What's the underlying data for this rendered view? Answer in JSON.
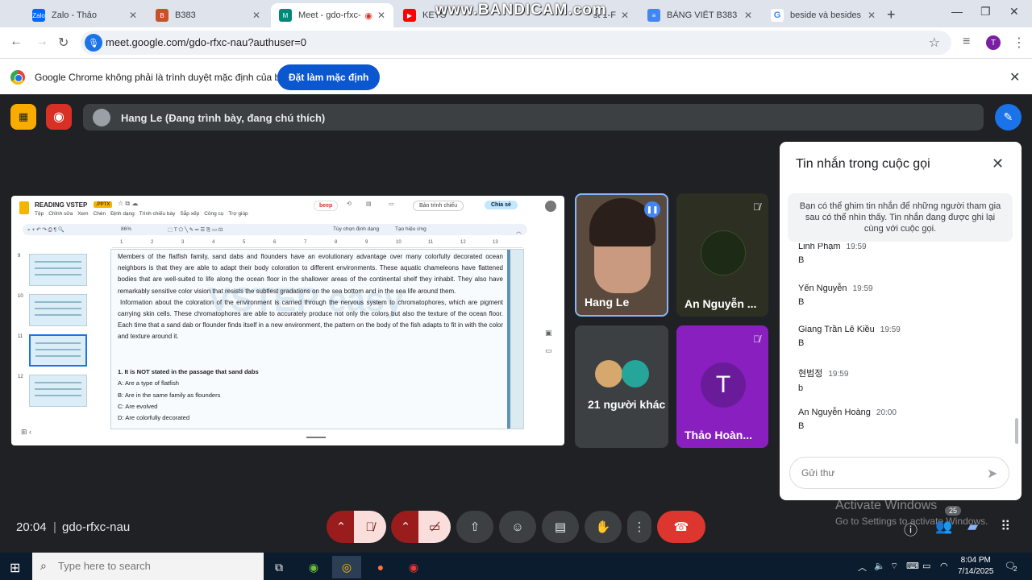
{
  "browser": {
    "tabs": [
      {
        "title": "Zalo - Thảo",
        "color": "#0068ff",
        "icon": "Zalo"
      },
      {
        "title": "B383",
        "color": "#c7522a",
        "icon": "B"
      },
      {
        "title": "Meet - gdo-rfxc-",
        "color": "#00897b",
        "icon": "M",
        "active": true
      },
      {
        "title": "KEYS",
        "color": "#ff0000",
        "icon": "▶"
      },
      {
        "title": "st 1-F",
        "color": "#5f6368",
        "icon": ""
      },
      {
        "title": "BẢNG VIẾT B383 - G",
        "color": "#4285f4",
        "icon": "≡"
      },
      {
        "title": "beside và besides - T",
        "color": "#4285f4",
        "icon": "G"
      }
    ],
    "watermark": "www.BANDICAM.com",
    "url": "meet.google.com/gdo-rfxc-nau?authuser=0",
    "profile_initial": "T"
  },
  "infobar": {
    "message": "Google Chrome không phải là trình duyệt mặc định của bạn",
    "button": "Đặt làm mặc định"
  },
  "presenter": {
    "label": "Hang Le (Đang trình bày, đang chú thích)"
  },
  "slides": {
    "title": "READING VSTEP",
    "badge": ".PPTX",
    "menus": [
      "Tệp",
      "Chỉnh sửa",
      "Xem",
      "Chèn",
      "Định dạng",
      "Trình chiếu bày",
      "Sắp xếp",
      "Công cụ",
      "Trợ giúp"
    ],
    "beep": "beep",
    "slideshow_button": "Bản trình chiếu",
    "share_button": "Chia sẻ",
    "zoom": "86%",
    "toolbar_format": "Tùy chọn định dạng",
    "toolbar_effect": "Tạo hiệu ứng",
    "ruler_marks": [
      "1",
      "2",
      "3",
      "4",
      "5",
      "6",
      "7",
      "8",
      "9",
      "10",
      "11",
      "12",
      "13"
    ],
    "thumb_numbers": [
      "9",
      "10",
      "11",
      "12"
    ],
    "passage_1": "Members of the flatfish family, sand dabs and flounders have an evolutionary advantage over many colorfully decorated ocean neighbors is that they are able to adapt their body coloration to different environments. These aquatic chameleons have flattened bodies that are well-suited to life along the ocean floor in the shallower areas of the continental shelf they inhabit. They also have remarkably sensitive color vision that resists the subtlest gradations on the sea bottom and in the sea life around them.",
    "passage_2": "Information about the coloration of the environment is carried through the nervous system to chromatophores, which are pigment carrying skin cells. These chromatophores are able to accurately produce not only the colors but also the texture of the ocean floor. Each time that a sand dab or flounder finds itself in a new environment, the pattern on the body of the fish adapts to fit in with the color and texture around it.",
    "question": "1. It is NOT stated in the passage that sand dabs",
    "options": [
      "A: Are a type of flatfish",
      "B: Are in the same family as flounders",
      "C: Are evolved",
      "D: Are colorfully decorated"
    ],
    "watermark": "VSTEP easy"
  },
  "participants": [
    {
      "name": "Hang Le",
      "bg": "#5a4a3e"
    },
    {
      "name": "An Nguyễn ...",
      "bg": "#2d2f22"
    },
    {
      "name": "21 người khác",
      "bg": "#3c4043"
    },
    {
      "name": "Thảo Hoàn...",
      "initial": "T",
      "bg": "#8a1fc0"
    }
  ],
  "chat": {
    "title": "Tin nhắn trong cuộc gọi",
    "notice": "Bạn có thể ghim tin nhắn để những người tham gia sau có thể nhìn thấy. Tin nhắn đang được ghi lại cùng với cuộc gọi.",
    "messages": [
      {
        "sender": "Linh Phạm",
        "time": "19:59",
        "text": "B"
      },
      {
        "sender": "Yến Nguyễn",
        "time": "19:59",
        "text": "B"
      },
      {
        "sender": "Giang Trần Lê Kiều",
        "time": "19:59",
        "text": "B"
      },
      {
        "sender": "현범정",
        "time": "19:59",
        "text": "b"
      },
      {
        "sender": "An Nguyễn Hoàng",
        "time": "20:00",
        "text": "B"
      }
    ],
    "input_placeholder": "Gửi thư"
  },
  "bottom": {
    "time": "20:04",
    "separator": "|",
    "meeting_code": "gdo-rfxc-nau",
    "people_count": "25",
    "activate_title": "Activate Windows",
    "activate_sub": "Go to Settings to activate Windows."
  },
  "taskbar": {
    "search_placeholder": "Type here to search",
    "time": "8:04 PM",
    "date": "7/14/2025",
    "notif_count": "2"
  }
}
